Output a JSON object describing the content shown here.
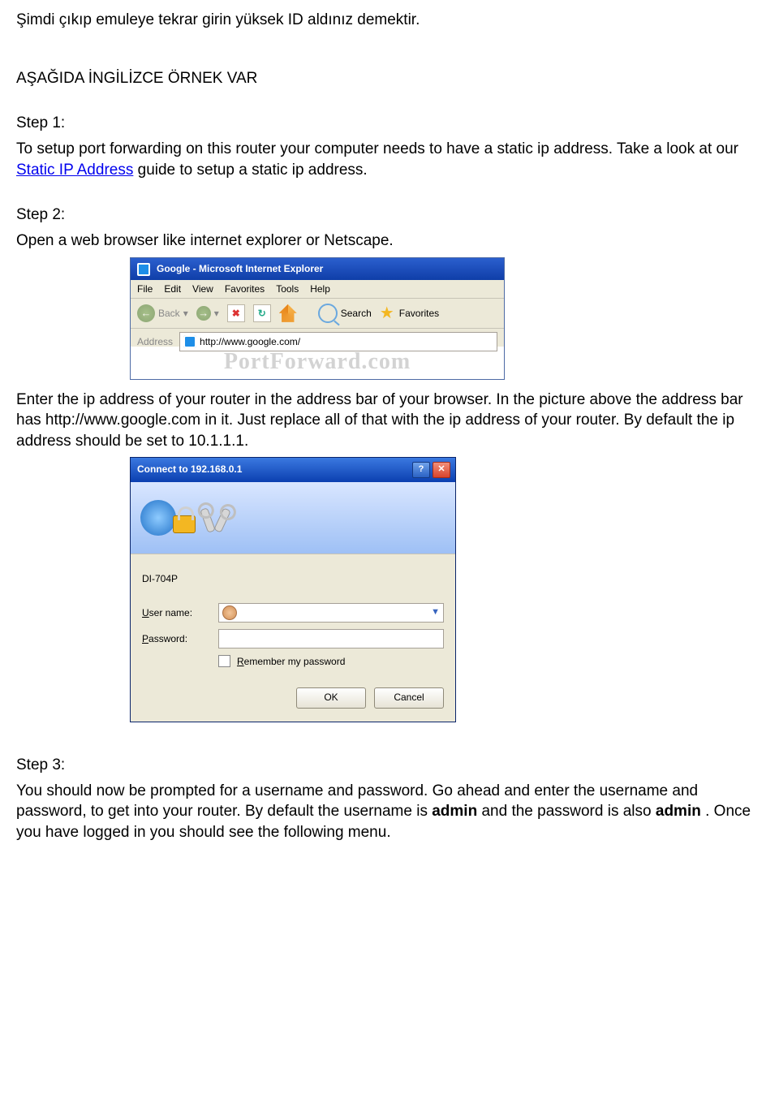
{
  "intro": "Şimdi çıkıp emuleye tekrar girin yüksek ID aldınız demektir.",
  "heading": "AŞAĞIDA İNGİLİZCE ÖRNEK VAR",
  "step1": {
    "title": "Step 1:",
    "text_before_link": "To setup port forwarding on this router your computer needs to have a static ip address. Take a look at our ",
    "link": "Static IP Address",
    "text_after_link": " guide to setup a static ip address."
  },
  "step2": {
    "title": "Step 2:",
    "text": "Open a web browser like internet explorer or Netscape."
  },
  "ie": {
    "title": "Google - Microsoft Internet Explorer",
    "menu": [
      "File",
      "Edit",
      "View",
      "Favorites",
      "Tools",
      "Help"
    ],
    "back": "Back",
    "search": "Search",
    "favorites": "Favorites",
    "address_label": "Address",
    "url": "http://www.google.com/",
    "watermark": "PortForward.com"
  },
  "para2": "Enter the ip address of your router in the address bar of your browser. In the picture above the address bar has http://www.google.com in it. Just replace all of that with the ip address of your router. By default the ip address should be set to 10.1.1.1.",
  "dlg": {
    "title": "Connect to 192.168.0.1",
    "device": "DI-704P",
    "user_label_pre": "U",
    "user_label_rest": "ser name:",
    "pass_label_pre": "P",
    "pass_label_rest": "assword:",
    "remember_pre": "R",
    "remember_rest": "emember my password",
    "ok": "OK",
    "cancel": "Cancel"
  },
  "step3": {
    "title": "Step 3:",
    "p_before_admin1": "You should now be prompted for a username and password. Go ahead and enter the username and password, to get into your router. By default the username is ",
    "admin1": "admin",
    "p_mid": " and the password is also ",
    "admin2": "admin",
    "p_after": " . Once you have logged in you should see the following menu."
  }
}
